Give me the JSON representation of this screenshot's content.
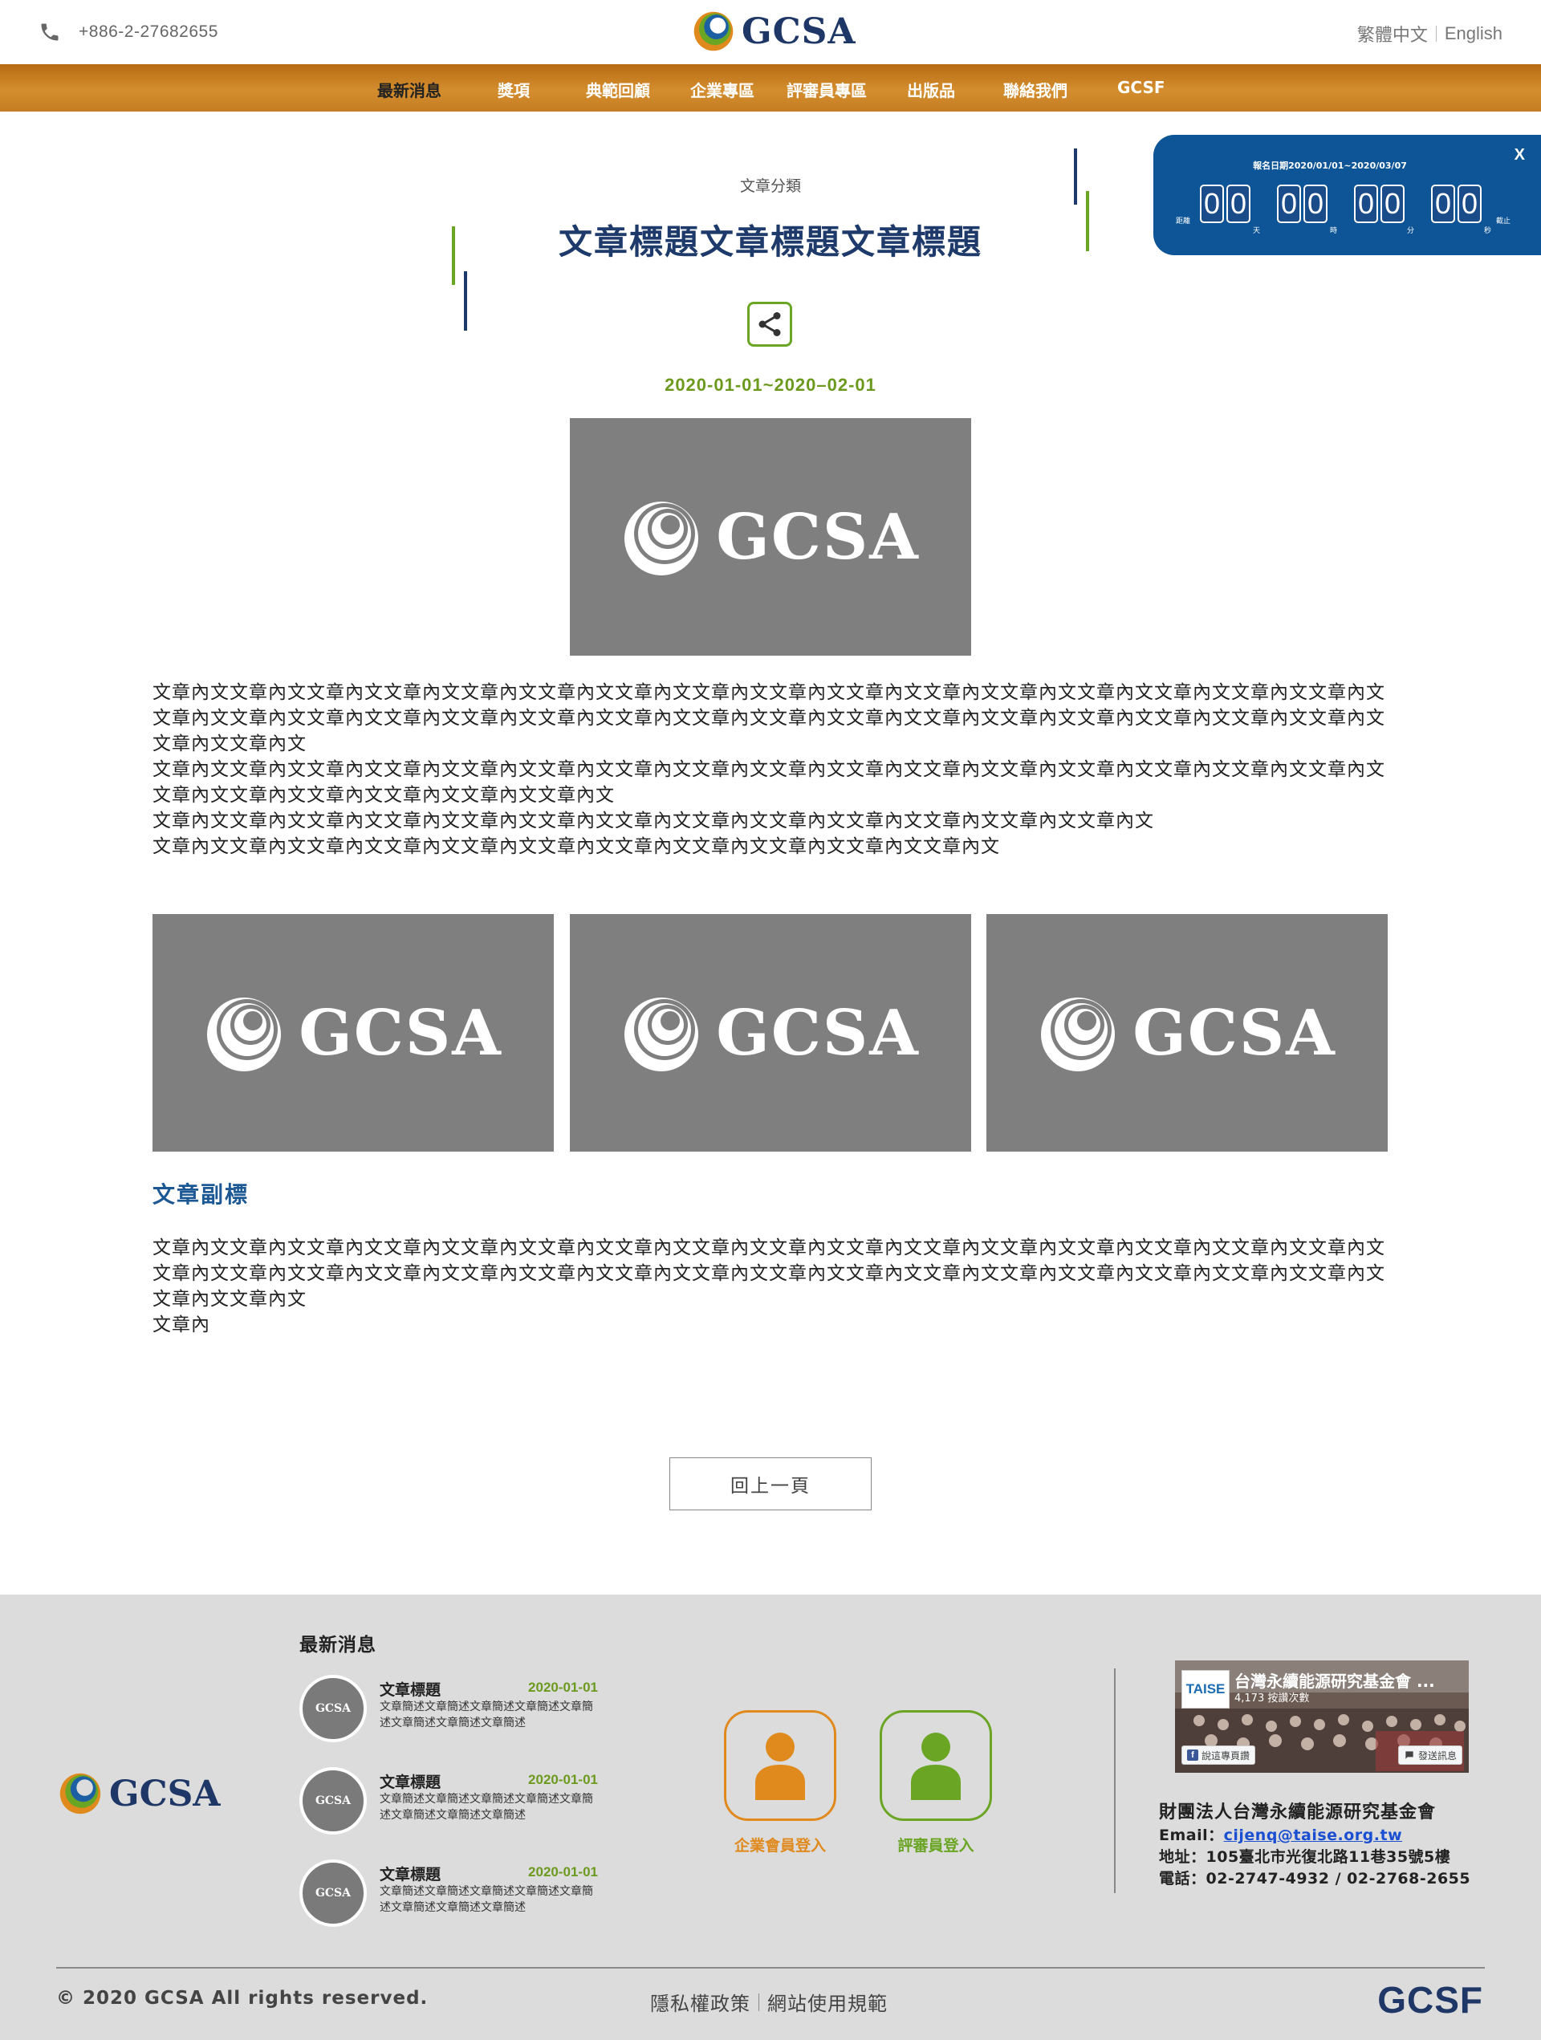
{
  "header": {
    "phone": "+886-2-27682655",
    "logo_text": "GCSA",
    "lang_zh": "繁體中文",
    "lang_en": "English"
  },
  "nav": {
    "items": [
      "最新消息",
      "獎項",
      "典範回顧",
      "企業專區",
      "評審員專區",
      "出版品",
      "聯絡我們",
      "GCSF"
    ]
  },
  "countdown": {
    "title": "報名日期2020/01/01~2020/03/07",
    "left_label": "距離",
    "right_label": "截止",
    "days": [
      "0",
      "0"
    ],
    "hours": [
      "0",
      "0"
    ],
    "minutes": [
      "0",
      "0"
    ],
    "seconds": [
      "0",
      "0"
    ],
    "units": [
      "天",
      "時",
      "分",
      "秒"
    ],
    "close": "X"
  },
  "article": {
    "category": "文章分類",
    "title": "文章標題文章標題文章標題",
    "date_range": "2020-01-01~2020–02-01",
    "image_text": "GCSA",
    "paragraphs": [
      "文章內文文章內文文章內文文章內文文章內文文章內文文章內文文章內文文章內文文章內文文章內文文章內文文章內文文章內文文章內文文章內文",
      "文章內文文章內文文章內文文章內文文章內文文章內文文章內文文章內文文章內文文章內文文章內文文章內文文章內文文章內文文章內文文章內文文章內文文章內文",
      "文章內文文章內文文章內文文章內文文章內文文章內文文章內文文章內文文章內文文章內文文章內文文章內文文章內文文章內文文章內文文章內文文章內文文章內文文章內文文章內文文章內文文章內文",
      "文章內文文章內文文章內文文章內文文章內文文章內文文章內文文章內文文章內文文章內文文章內文文章內文文章內文",
      "文章內文文章內文文章內文文章內文文章內文文章內文文章內文文章內文文章內文文章內文文章內文"
    ],
    "gallery": [
      "GCSA",
      "GCSA",
      "GCSA"
    ],
    "subtitle": "文章副標",
    "paragraphs2": [
      "文章內文文章內文文章內文文章內文文章內文文章內文文章內文文章內文文章內文文章內文文章內文文章內文文章內文文章內文文章內文文章內文",
      "文章內文文章內文文章內文文章內文文章內文文章內文文章內文文章內文文章內文文章內文文章內文文章內文文章內文文章內文文章內文文章內文文章內文文章內文",
      "文章內"
    ],
    "back_label": "回上一頁"
  },
  "footer": {
    "logo_text": "GCSA",
    "news_heading": "最新消息",
    "news": [
      {
        "title": "文章標題",
        "date": "2020-01-01",
        "desc": "文章簡述文章簡述文章簡述文章簡述文章簡述文章簡述文章簡述文章簡述",
        "thumb": "GCSA"
      },
      {
        "title": "文章標題",
        "date": "2020-01-01",
        "desc": "文章簡述文章簡述文章簡述文章簡述文章簡述文章簡述文章簡述文章簡述",
        "thumb": "GCSA"
      },
      {
        "title": "文章標題",
        "date": "2020-01-01",
        "desc": "文章簡述文章簡述文章簡述文章簡述文章簡述文章簡述文章簡述文章簡述",
        "thumb": "GCSA"
      }
    ],
    "login_company": "企業會員登入",
    "login_judge": "評審員登入",
    "fb": {
      "logo": "TAISE",
      "name": "台灣永續能源研究基金會 ...",
      "likes": "4,173 按讚次數",
      "like_btn": "說這專頁讚",
      "msg_btn": "發送訊息"
    },
    "org_name": "財團法人台灣永續能源研究基金會",
    "email_label": "Email：",
    "email": "cijenq@taise.org.tw",
    "address": "地址：105臺北市光復北路11巷35號5樓",
    "phone": "電話：02-2747-4932 / 02-2768-2655",
    "copyright": "© 2020 GCSA All rights reserved.",
    "privacy": "隱私權政策",
    "terms": "網站使用規範",
    "brand": "GCSF"
  },
  "colors": {
    "nav_orange": "#c87a1c",
    "navy": "#1d3a6b",
    "green": "#6c9a1f",
    "countdown_blue": "#0d5596",
    "company_orange": "#e08a1e",
    "judge_green": "#6aa524"
  },
  "icons": [
    "phone-icon",
    "gcsa-logo-icon",
    "share-icon",
    "user-icon",
    "facebook-icon",
    "message-icon"
  ]
}
